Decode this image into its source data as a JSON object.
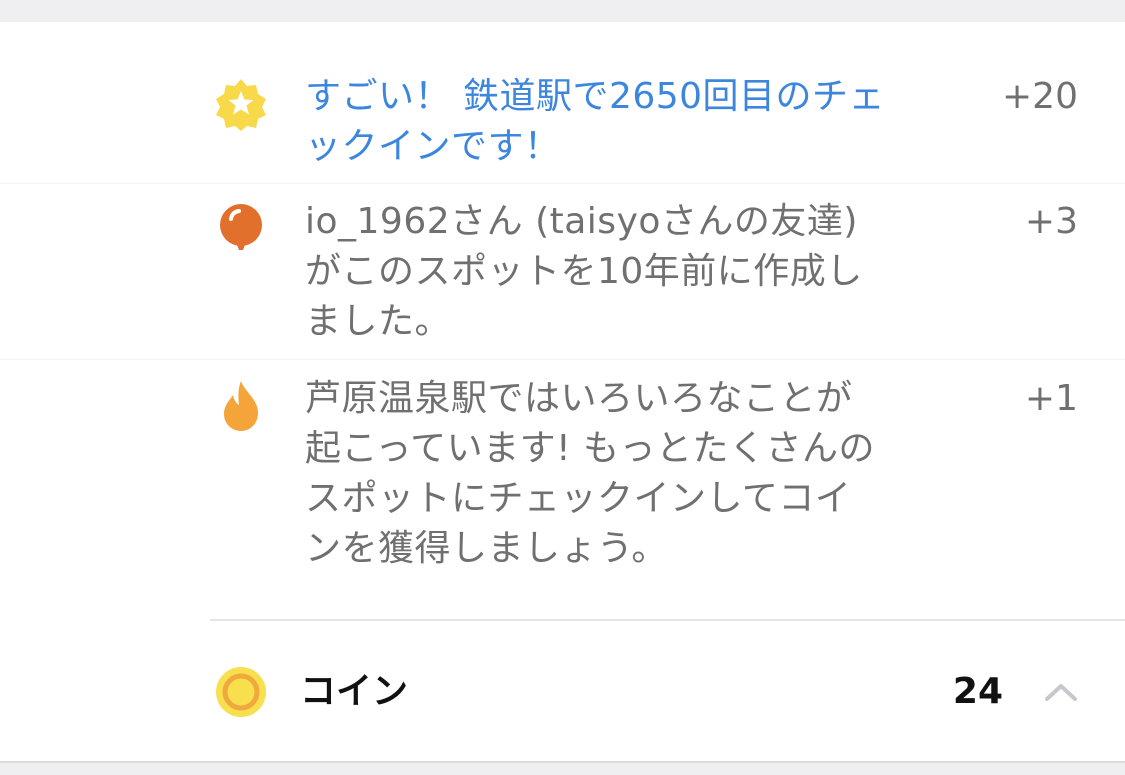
{
  "notifications": [
    {
      "icon": "star-badge-icon",
      "text_lines": [
        "すごい！ 鉄道駅で2650回目のチェ",
        "ックインです！"
      ],
      "points": "+20",
      "color": "#3d86de"
    },
    {
      "icon": "balloon-icon",
      "text_lines": [
        "io_1962さん (taisyoさんの友達)",
        "がこのスポットを10年前に作成し",
        "ました。"
      ],
      "points": "+3",
      "color": "#707070"
    },
    {
      "icon": "flame-icon",
      "text_lines": [
        "芦原温泉駅ではいろいろなことが",
        "起こっています! もっとたくさんの",
        "スポットにチェックインしてコイ",
        "ンを獲得しましょう。"
      ],
      "points": "+1",
      "color": "#707070"
    }
  ],
  "coins": {
    "label": "コイン",
    "count": "24",
    "icon": "coin-icon",
    "toggle_icon": "chevron-up-icon"
  },
  "colors": {
    "accent_blue": "#3d86de",
    "star_yellow": "#f8d94a",
    "balloon_orange": "#e0702c",
    "flame_orange": "#f5a43a",
    "coin_yellow": "#f7df4e"
  }
}
